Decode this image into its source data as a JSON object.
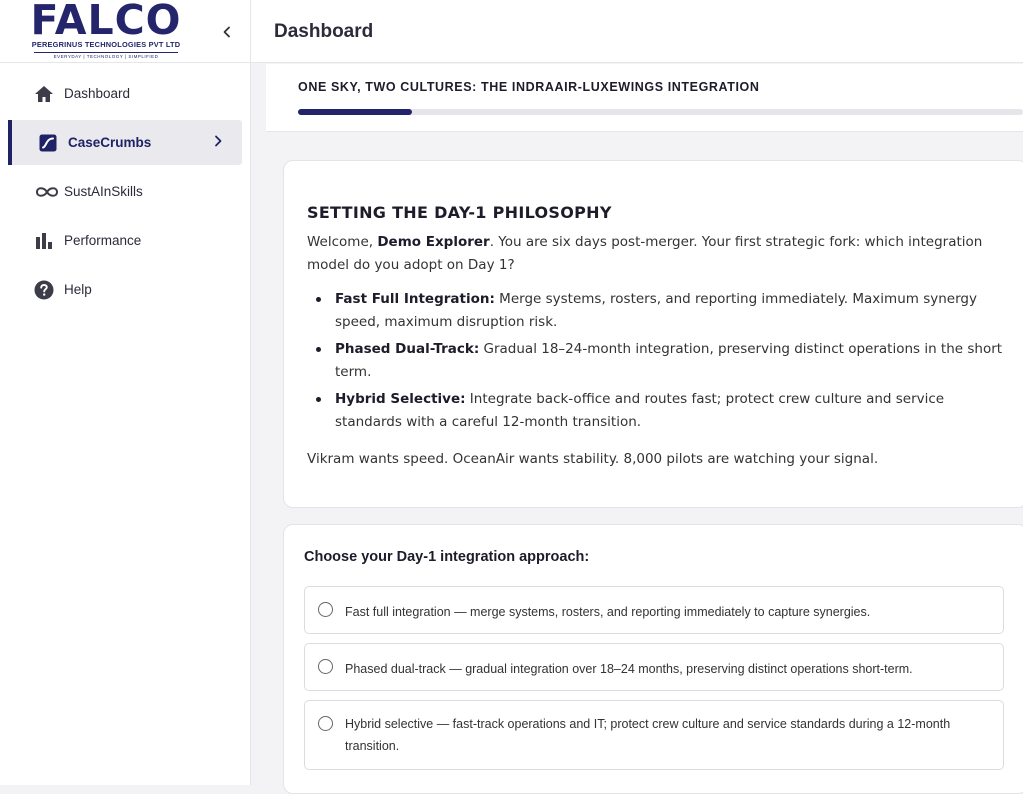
{
  "logo": {
    "main": "FALCO",
    "sub": "PEREGRINUS TECHNOLOGIES PVT LTD",
    "tagline": "EVERYDAY | TECHNOLOGY | SIMPLIFIED"
  },
  "header": {
    "title": "Dashboard"
  },
  "sidebar": {
    "items": [
      {
        "label": "Dashboard",
        "icon": "home-icon",
        "active": false
      },
      {
        "label": "CaseCrumbs",
        "icon": "casecrumbs-icon",
        "active": true
      },
      {
        "label": "SustAInSkills",
        "icon": "infinity-icon",
        "active": false
      },
      {
        "label": "Performance",
        "icon": "bar-chart-icon",
        "active": false
      },
      {
        "label": "Help",
        "icon": "help-icon",
        "active": false
      }
    ]
  },
  "case": {
    "title": "ONE SKY, TWO CULTURES: THE INDRAAIR-LUXEWINGS INTEGRATION",
    "progress": 0.157
  },
  "scenario": {
    "heading": "SETTING THE DAY-1 PHILOSOPHY",
    "intro_prefix": "Welcome, ",
    "user_name": "Demo Explorer",
    "intro_suffix": ". You are six days post-merger. Your first strategic fork: which integration model do you adopt on Day 1?",
    "bullets": [
      {
        "term": "Fast Full Integration:",
        "text": " Merge systems, rosters, and reporting immediately. Maximum synergy speed, maximum disruption risk."
      },
      {
        "term": "Phased Dual-Track:",
        "text": " Gradual 18–24-month integration, preserving distinct operations in the short term."
      },
      {
        "term": "Hybrid Selective:",
        "text": " Integrate back-office and routes fast; protect crew culture and service standards with a careful 12-month transition."
      }
    ],
    "closing": "Vikram wants speed. OceanAir wants stability. 8,000 pilots are watching your signal."
  },
  "question": {
    "prompt": "Choose your Day-1 integration approach:",
    "options": [
      "Fast full integration — merge systems, rosters, and reporting immediately to capture synergies.",
      "Phased dual-track — gradual integration over 18–24 months, preserving distinct operations short-term.",
      "Hybrid selective — fast-track operations and IT; protect crew culture and service standards during a 12-month transition."
    ]
  },
  "colors": {
    "brand": "#23236b",
    "active_bg": "#e9e9ee",
    "page_bg": "#f3f3f5"
  }
}
